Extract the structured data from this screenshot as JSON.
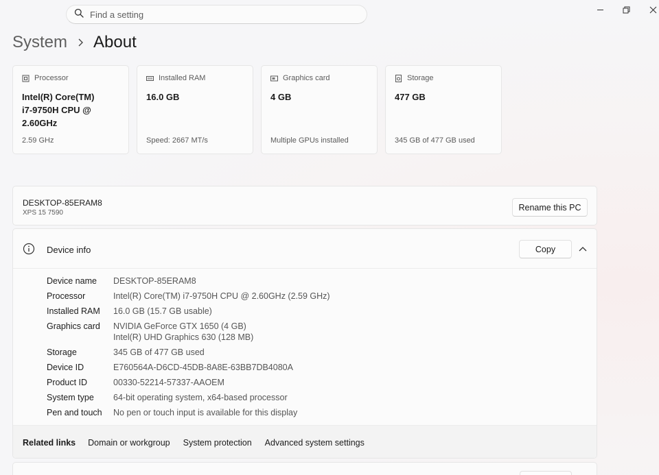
{
  "search": {
    "placeholder": "Find a setting"
  },
  "window": {
    "minimize": "minimize-icon",
    "restore": "restore-icon",
    "close": "close-icon"
  },
  "breadcrumb": {
    "parent": "System",
    "current": "About"
  },
  "cards": [
    {
      "label": "Processor",
      "icon": "cpu-icon",
      "value": "Intel(R) Core(TM) i7-9750H CPU @ 2.60GHz",
      "sub": "2.59 GHz"
    },
    {
      "label": "Installed RAM",
      "icon": "ram-icon",
      "value": "16.0 GB",
      "sub": "Speed: 2667 MT/s"
    },
    {
      "label": "Graphics card",
      "icon": "gpu-icon",
      "value": "4 GB",
      "sub": "Multiple GPUs installed"
    },
    {
      "label": "Storage",
      "icon": "storage-icon",
      "value": "477 GB",
      "sub": "345 GB of 477 GB used"
    }
  ],
  "pc": {
    "name": "DESKTOP-85ERAM8",
    "model": "XPS 15 7590",
    "rename_label": "Rename this PC"
  },
  "device_info": {
    "title": "Device info",
    "copy_label": "Copy",
    "specs": [
      {
        "key": "Device name",
        "value": "DESKTOP-85ERAM8"
      },
      {
        "key": "Processor",
        "value": "Intel(R) Core(TM) i7-9750H CPU @ 2.60GHz (2.59 GHz)"
      },
      {
        "key": "Installed RAM",
        "value": "16.0 GB (15.7 GB usable)"
      },
      {
        "key": "Graphics card",
        "value": "NVIDIA GeForce GTX 1650 (4 GB)",
        "value2": "Intel(R) UHD Graphics 630 (128 MB)"
      },
      {
        "key": "Storage",
        "value": "345 GB of 477 GB used"
      },
      {
        "key": "Device ID",
        "value": "E760564A-D6CD-45DB-8A8E-63BB7DB4080A"
      },
      {
        "key": "Product ID",
        "value": "00330-52214-57337-AAOEM"
      },
      {
        "key": "System type",
        "value": "64-bit operating system, x64-based processor"
      },
      {
        "key": "Pen and touch",
        "value": "No pen or touch input is available for this display"
      }
    ]
  },
  "related": {
    "label": "Related links",
    "links": [
      "Domain or workgroup",
      "System protection",
      "Advanced system settings"
    ]
  },
  "colors": {
    "accent": "#1b1b1b",
    "secondary_text": "#5a5a5a",
    "card_bg": "#fbfbfb"
  }
}
